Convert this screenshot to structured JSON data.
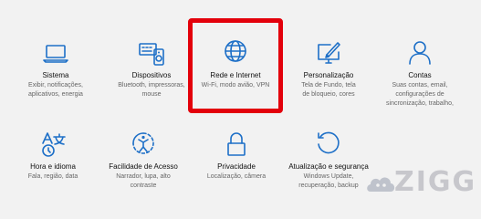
{
  "tiles": [
    {
      "title": "Sistema",
      "desc": [
        "Exibir, notificações,",
        "aplicativos, energia"
      ],
      "icon": "laptop-icon"
    },
    {
      "title": "Dispositivos",
      "desc": [
        "Bluetooth, impressoras,",
        "mouse"
      ],
      "icon": "keyboard-speaker-icon"
    },
    {
      "title": "Rede e Internet",
      "desc": [
        "Wi-Fi, modo avião, VPN"
      ],
      "icon": "globe-icon"
    },
    {
      "title": "Personalização",
      "desc": [
        "Tela de Fundo, tela",
        "de bloqueio, cores"
      ],
      "icon": "paint-brush-monitor-icon"
    },
    {
      "title": "Contas",
      "desc": [
        "Suas contas, email,",
        "configurações de",
        "sincronização, trabalho,"
      ],
      "icon": "person-icon"
    },
    {
      "title": "Hora e idioma",
      "desc": [
        "Fala, região, data"
      ],
      "icon": "time-language-icon"
    },
    {
      "title": "Facilidade de Acesso",
      "desc": [
        "Narrador, lupa, alto",
        "contraste"
      ],
      "icon": "ease-of-access-icon"
    },
    {
      "title": "Privacidade",
      "desc": [
        "Localização, câmera"
      ],
      "icon": "lock-icon"
    },
    {
      "title": "Atualização e segurança",
      "desc": [
        "Windows Update,",
        "recuperação, backup"
      ],
      "icon": "refresh-icon"
    }
  ],
  "watermark": {
    "text": "ZIGG",
    "icon": "cloud-mascot-icon"
  },
  "colors": {
    "accent": "#1d6fc7",
    "highlight": "#e3000b",
    "background": "#f2f2f2"
  }
}
